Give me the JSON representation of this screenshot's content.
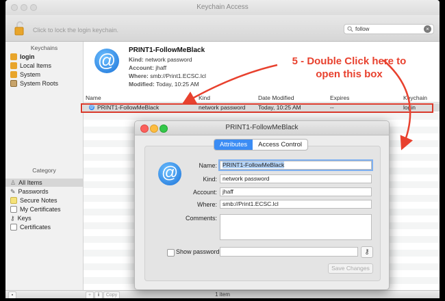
{
  "window": {
    "title": "Keychain Access",
    "lock_hint": "Click to lock the login keychain.",
    "search_value": "follow"
  },
  "sidebar": {
    "keychains_header": "Keychains",
    "keychains": [
      {
        "label": "login",
        "icon": "lock-open-icon"
      },
      {
        "label": "Local Items",
        "icon": "lock-open-icon"
      },
      {
        "label": "System",
        "icon": "lock-icon"
      },
      {
        "label": "System Roots",
        "icon": "cabinet-icon"
      }
    ],
    "category_header": "Category",
    "categories": [
      {
        "label": "All Items",
        "icon": "people-icon"
      },
      {
        "label": "Passwords",
        "icon": "pencil-icon"
      },
      {
        "label": "Secure Notes",
        "icon": "note-icon"
      },
      {
        "label": "My Certificates",
        "icon": "certificate-icon"
      },
      {
        "label": "Keys",
        "icon": "key-icon"
      },
      {
        "label": "Certificates",
        "icon": "certificate-icon"
      }
    ]
  },
  "summary": {
    "icon_glyph": "@",
    "title": "PRINT1-FollowMeBlack",
    "kind_label": "Kind:",
    "kind": "network password",
    "account_label": "Account:",
    "account": "jhaff",
    "where_label": "Where:",
    "where": "smb://Print1.ECSC.lcl",
    "modified_label": "Modified:",
    "modified": "Today, 10:25 AM"
  },
  "table": {
    "columns": [
      "Name",
      "Kind",
      "Date Modified",
      "Expires",
      "Keychain"
    ],
    "rows": [
      {
        "name": "PRINT1-FollowMeBlack",
        "kind": "network password",
        "date": "Today, 10:25 AM",
        "expires": "--",
        "keychain": "login"
      }
    ]
  },
  "annotation": {
    "line1": "5 - Double Click here to",
    "line2": "open this box",
    "color": "#e8412e"
  },
  "footer": {
    "add": "+",
    "info": "i",
    "copy": "Copy",
    "count": "1 item"
  },
  "dialog": {
    "title": "PRINT1-FollowMeBlack",
    "tabs": [
      {
        "label": "Attributes",
        "active": true
      },
      {
        "label": "Access Control",
        "active": false
      }
    ],
    "icon_glyph": "@",
    "name_label": "Name:",
    "name_value": "PRINT1-FollowMeBlack",
    "kind_label": "Kind:",
    "kind_value": "network password",
    "account_label": "Account:",
    "account_value": "jhaff",
    "where_label": "Where:",
    "where_value": "smb://Print1.ECSC.lcl",
    "comments_label": "Comments:",
    "show_password_label": "Show password:",
    "key_glyph": "⚷",
    "save_label": "Save Changes"
  },
  "colors": {
    "accent": "#3b8cf4",
    "annotation_red": "#d9382a"
  }
}
